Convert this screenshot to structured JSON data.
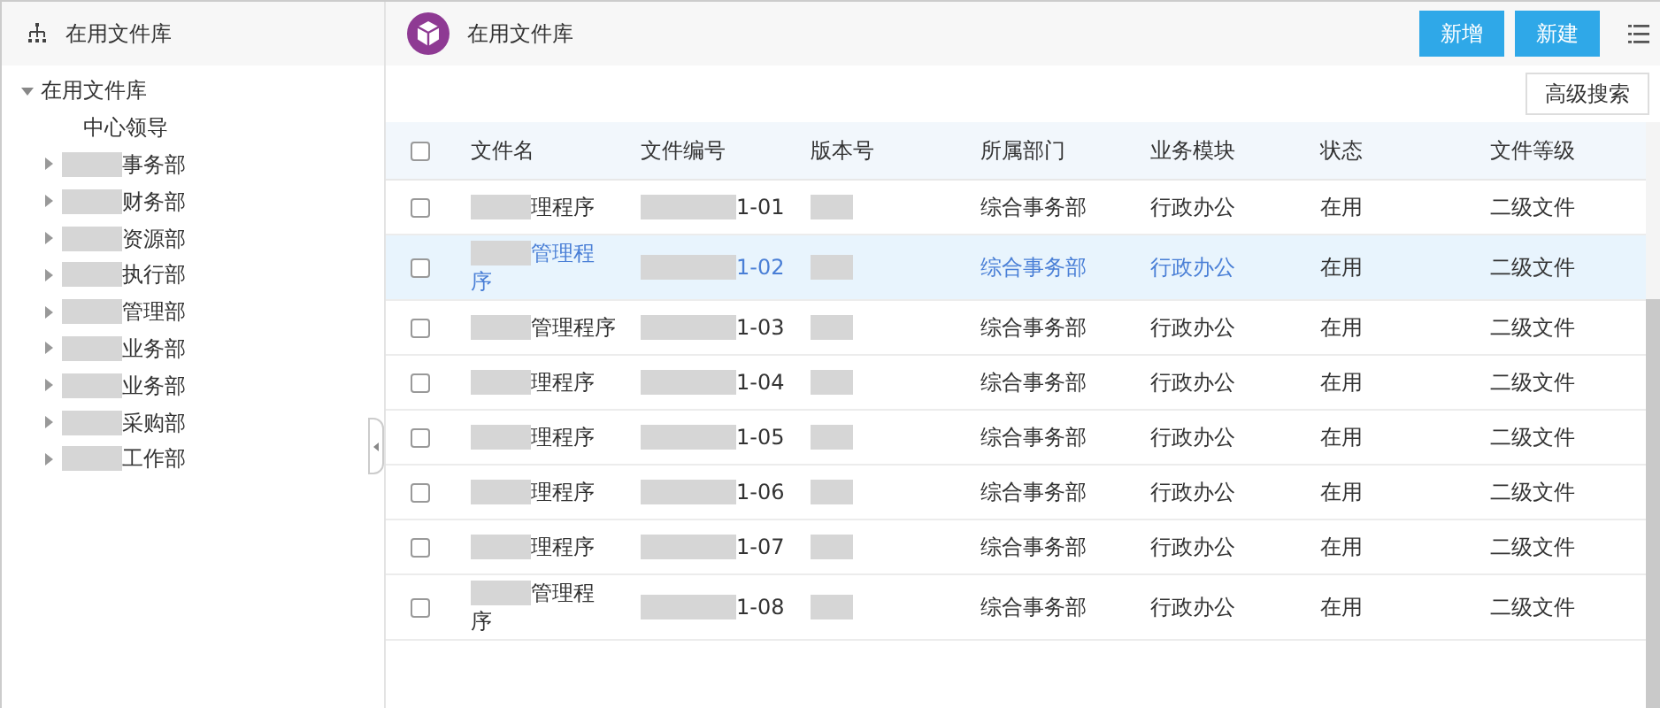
{
  "sidebar": {
    "title": "在用文件库",
    "tree": [
      {
        "label": "在用文件库",
        "expanded": true,
        "children": [
          {
            "label": "中心领导"
          },
          {
            "label": "事务部",
            "expanded": false,
            "blurred": true
          },
          {
            "label": "财务部",
            "expanded": false,
            "blurred": true
          },
          {
            "label": "资源部",
            "expanded": false,
            "blurred": true
          },
          {
            "label": "执行部",
            "expanded": false,
            "blurred": true
          },
          {
            "label": "管理部",
            "expanded": false,
            "blurred": true
          },
          {
            "label": "业务部",
            "expanded": false,
            "blurred": true
          },
          {
            "label": "业务部",
            "expanded": false,
            "blurred": true
          },
          {
            "label": "采购部",
            "expanded": false,
            "blurred": true
          },
          {
            "label": "工作部",
            "expanded": false,
            "blurred": true
          }
        ]
      }
    ]
  },
  "header": {
    "title": "在用文件库",
    "buttons": [
      "新增",
      "新建"
    ]
  },
  "toolbar": {
    "advanced_search": "高级搜索"
  },
  "table": {
    "header_checked": false,
    "columns": [
      "文件名",
      "文件编号",
      "版本号",
      "所属部门",
      "业务模块",
      "状态",
      "文件等级"
    ],
    "rows": [
      {
        "selected": false,
        "checked": false,
        "name": {
          "text": "理程序",
          "blurred": true
        },
        "number": {
          "text": "1-01",
          "blurred": true
        },
        "version": {
          "blurred": true
        },
        "department": "综合事务部",
        "module": "行政办公",
        "status": "在用",
        "grade": "二级文件"
      },
      {
        "selected": true,
        "checked": false,
        "name": {
          "text": "管理程",
          "tail": "序",
          "blurred": true
        },
        "number": {
          "text": "1-02",
          "blurred": true
        },
        "version": {
          "blurred": true
        },
        "department": "综合事务部",
        "module": "行政办公",
        "status": "在用",
        "grade": "二级文件"
      },
      {
        "selected": false,
        "checked": false,
        "name": {
          "text": "管理程序",
          "blurred": true
        },
        "number": {
          "text": "1-03",
          "blurred": true
        },
        "version": {
          "blurred": true
        },
        "department": "综合事务部",
        "module": "行政办公",
        "status": "在用",
        "grade": "二级文件"
      },
      {
        "selected": false,
        "checked": false,
        "name": {
          "text": "理程序",
          "blurred": true
        },
        "number": {
          "text": "1-04",
          "blurred": true
        },
        "version": {
          "blurred": true
        },
        "department": "综合事务部",
        "module": "行政办公",
        "status": "在用",
        "grade": "二级文件"
      },
      {
        "selected": false,
        "checked": false,
        "name": {
          "text": "理程序",
          "blurred": true
        },
        "number": {
          "text": "1-05",
          "blurred": true
        },
        "version": {
          "blurred": true
        },
        "department": "综合事务部",
        "module": "行政办公",
        "status": "在用",
        "grade": "二级文件"
      },
      {
        "selected": false,
        "checked": false,
        "name": {
          "text": "理程序",
          "blurred": true
        },
        "number": {
          "text": "1-06",
          "blurred": true
        },
        "version": {
          "blurred": true
        },
        "department": "综合事务部",
        "module": "行政办公",
        "status": "在用",
        "grade": "二级文件"
      },
      {
        "selected": false,
        "checked": false,
        "name": {
          "text": "理程序",
          "blurred": true
        },
        "number": {
          "text": "1-07",
          "blurred": true
        },
        "version": {
          "blurred": true
        },
        "department": "综合事务部",
        "module": "行政办公",
        "status": "在用",
        "grade": "二级文件"
      },
      {
        "selected": false,
        "checked": false,
        "name": {
          "text": "管理程",
          "tail": "序",
          "blurred": true
        },
        "number": {
          "text": "1-08",
          "blurred": true
        },
        "version": {
          "blurred": true
        },
        "department": "综合事务部",
        "module": "行政办公",
        "status": "在用",
        "grade": "二级文件"
      }
    ]
  }
}
